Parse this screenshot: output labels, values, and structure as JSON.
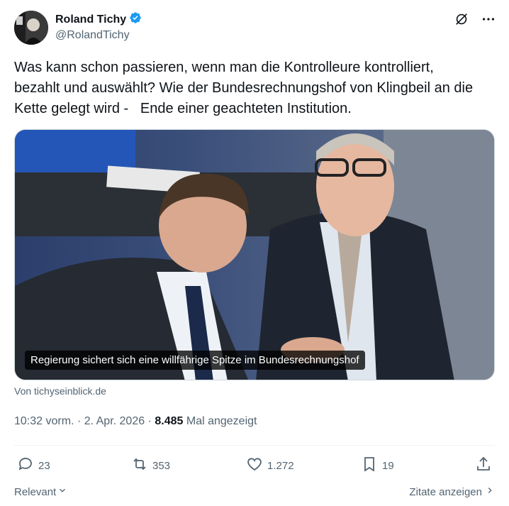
{
  "author": {
    "display_name": "Roland Tichy",
    "handle": "@RolandTichy",
    "verified": true
  },
  "header_icons": [
    "grok-icon",
    "more-icon"
  ],
  "tweet": {
    "text": "Was kann schon passieren, wenn man die Kontrolleure kontrolliert,\nbezahlt und auswählt? Wie der Bundesrechnungshof von Klingbeil an die\nKette gelegt wird -   Ende einer geachteten Institution."
  },
  "media": {
    "caption": "Regierung sichert sich eine willfährige Spitze im Bundesrechnungshof",
    "source": "Von tichyseinblick.de"
  },
  "meta": {
    "time": "10:32 vorm.",
    "date": "2. Apr. 2026",
    "views_count": "8.485",
    "views_label": "Mal angezeigt",
    "separator": "·"
  },
  "actions": {
    "replies": "23",
    "reposts": "353",
    "likes": "1.272",
    "bookmarks": "19"
  },
  "footer": {
    "sort_label": "Relevant",
    "quotes_label": "Zitate anzeigen"
  },
  "colors": {
    "verified_blue": "#1d9bf0",
    "muted_text": "#536471",
    "primary_text": "#0f1419"
  }
}
